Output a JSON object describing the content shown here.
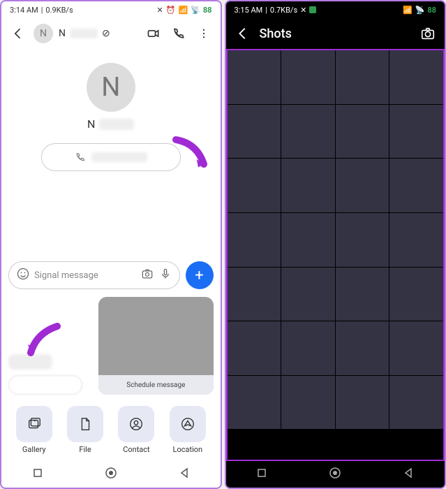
{
  "left": {
    "status": {
      "time": "3:14 AM",
      "speed": "0.9KB/s",
      "battery": "88"
    },
    "header": {
      "name_initial": "N",
      "name": "N"
    },
    "profile": {
      "initial": "N",
      "name": "N"
    },
    "input": {
      "placeholder": "Signal message"
    },
    "sheet": {
      "schedule": "Schedule message"
    },
    "attach": {
      "gallery": "Gallery",
      "file": "File",
      "contact": "Contact",
      "location": "Location"
    }
  },
  "right": {
    "status": {
      "time": "3:15 AM",
      "speed": "0.7KB/s",
      "battery": "88"
    },
    "header": {
      "title": "Shots"
    },
    "cells": 28
  }
}
